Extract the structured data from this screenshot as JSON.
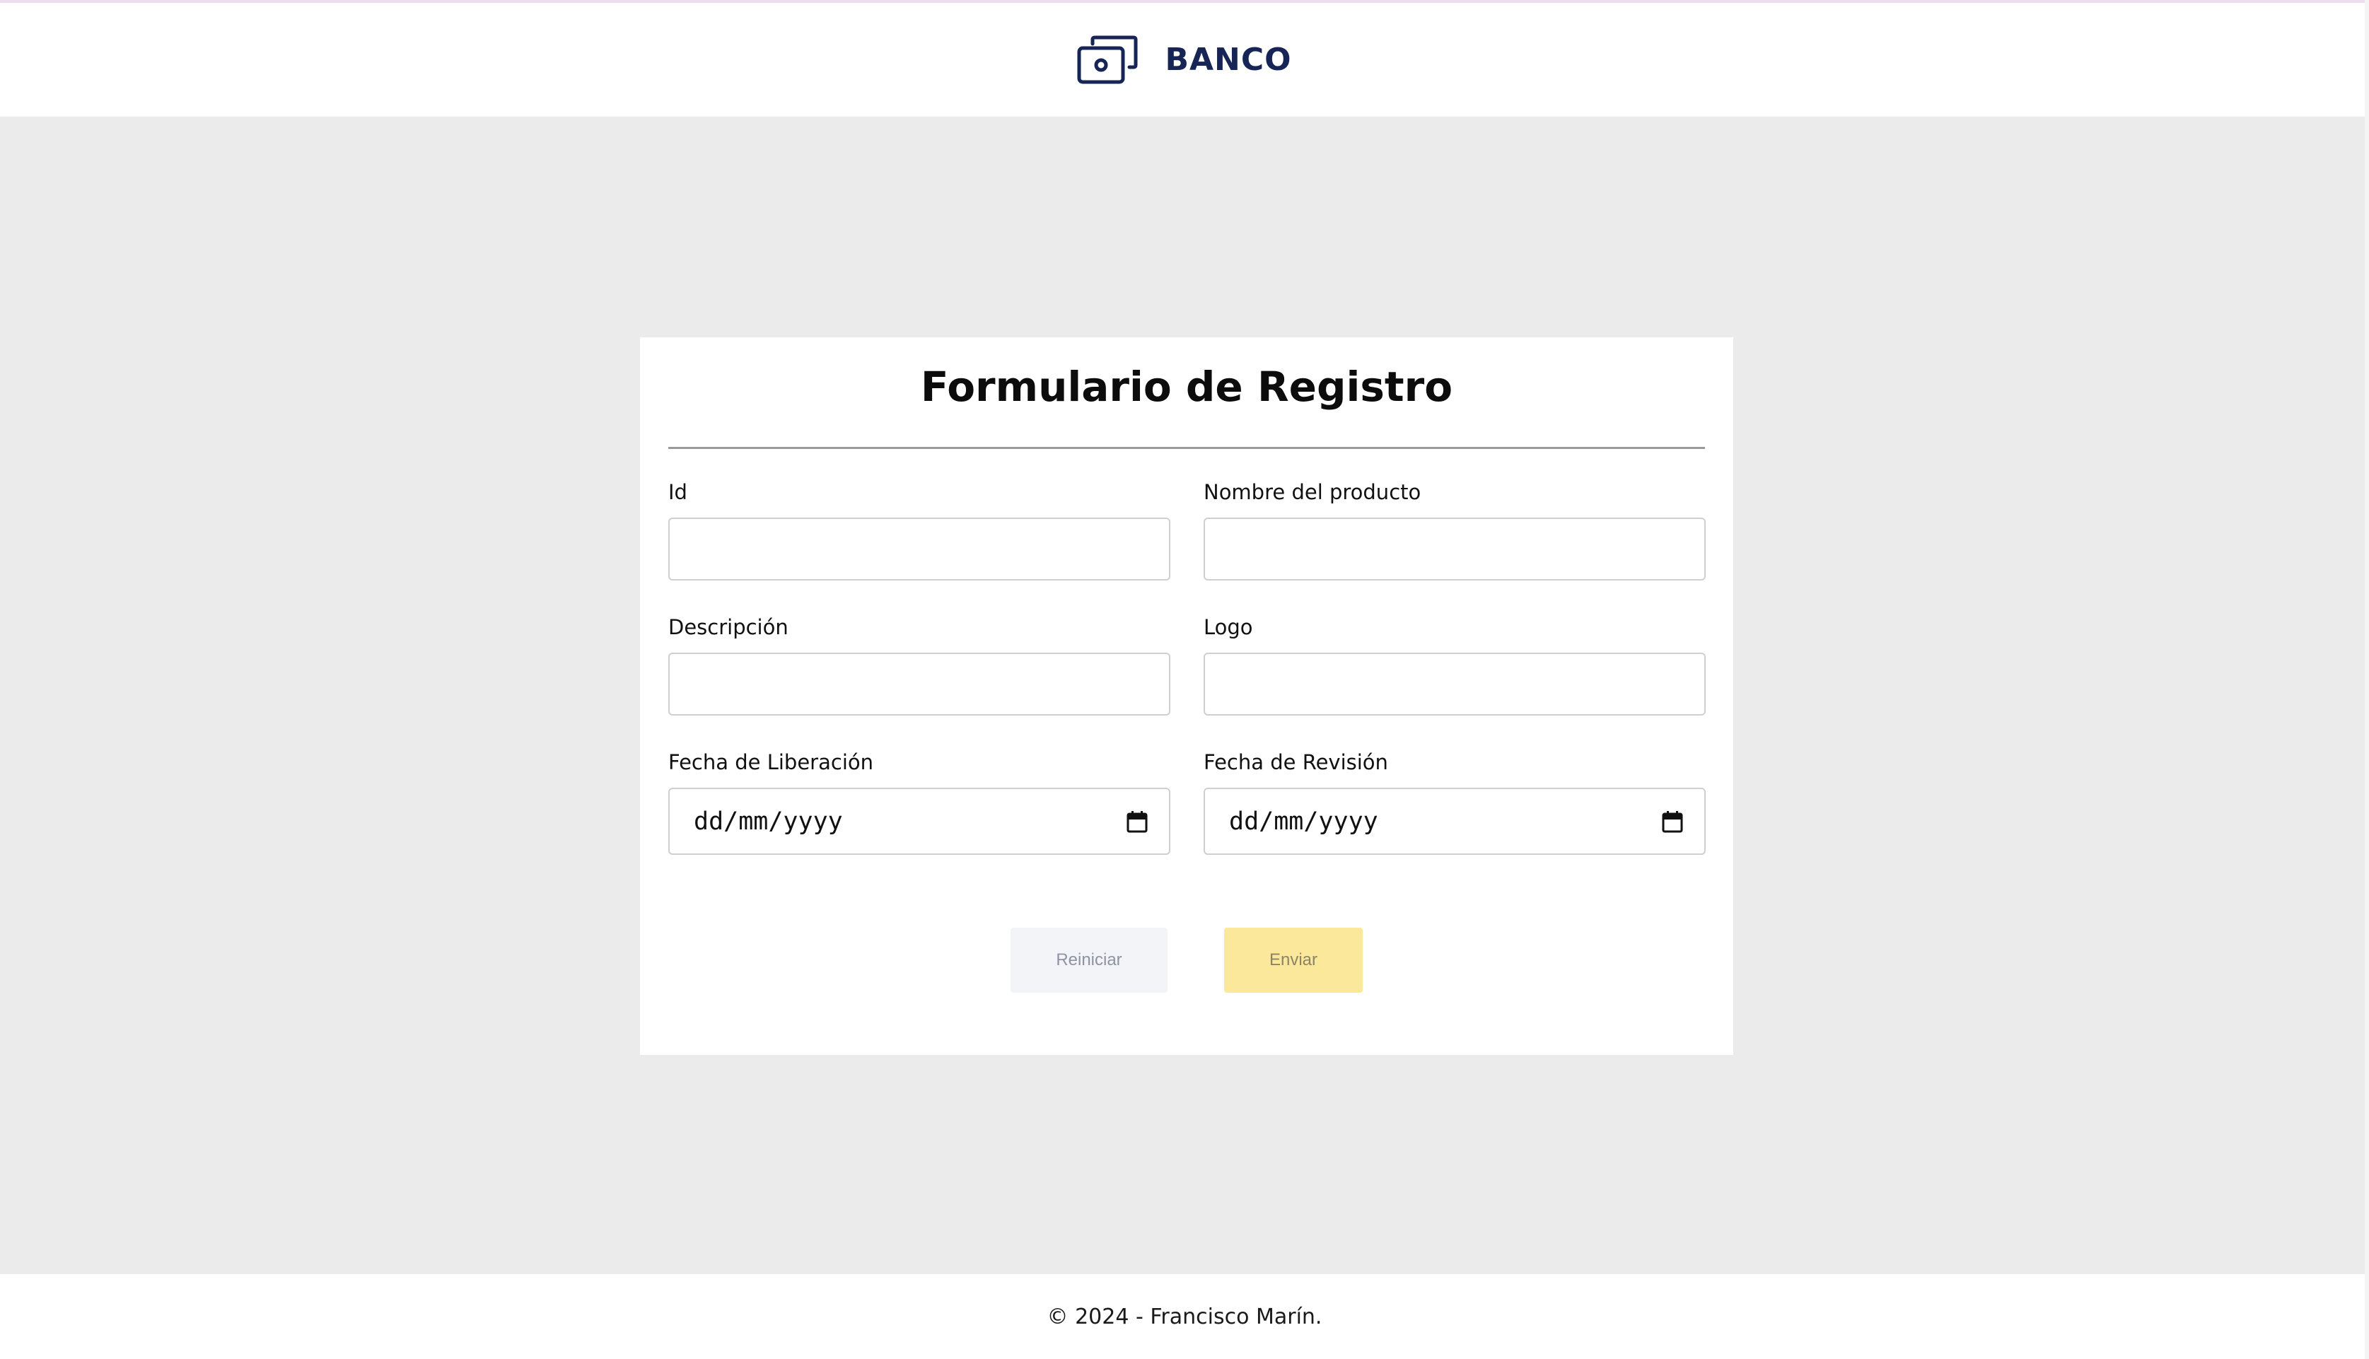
{
  "header": {
    "brand_icon": "banknote-icon",
    "brand_name": "BANCO"
  },
  "form": {
    "title": "Formulario de Registro",
    "fields": {
      "id": {
        "label": "Id",
        "value": ""
      },
      "product_name": {
        "label": "Nombre del producto",
        "value": ""
      },
      "description": {
        "label": "Descripción",
        "value": ""
      },
      "logo": {
        "label": "Logo",
        "value": ""
      },
      "release_date": {
        "label": "Fecha de Liberación",
        "value": "dd/mm/yyyy",
        "icon": "calendar-icon"
      },
      "revision_date": {
        "label": "Fecha de Revisión",
        "value": "dd/mm/yyyy",
        "icon": "calendar-icon"
      }
    },
    "buttons": {
      "reset_label": "Reiniciar",
      "submit_label": "Enviar"
    }
  },
  "footer": {
    "text": "© 2024 - Francisco Marín."
  },
  "colors": {
    "brand": "#162456",
    "background": "#ebebeb",
    "submit_button": "#fbe89b",
    "reset_button": "#f3f4f7"
  }
}
